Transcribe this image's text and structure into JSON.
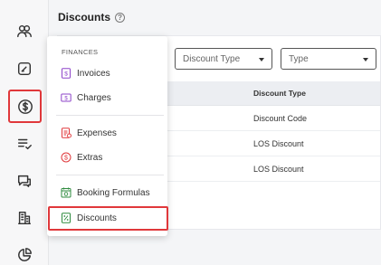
{
  "colors": {
    "accent_red": "#e0383b",
    "purple": "#8e44c9",
    "orange": "#e08a2c",
    "green": "#2e8b3e"
  },
  "header": {
    "title": "Discounts",
    "help_icon": "?"
  },
  "sidebar": {
    "icons": [
      "users-icon",
      "edit-icon",
      "dollar-icon",
      "checklist-icon",
      "chat-icon",
      "building-icon",
      "pie-chart-icon"
    ],
    "active": "dollar-icon"
  },
  "filters": {
    "discount_type": {
      "value": "Discount Type"
    },
    "type": {
      "value": "Type"
    }
  },
  "table": {
    "header": "Discount Type",
    "rows": [
      "Discount Code",
      "LOS Discount",
      "LOS Discount"
    ]
  },
  "menu": {
    "heading": "FINANCES",
    "items": [
      {
        "label": "Invoices",
        "icon": "invoice-icon"
      },
      {
        "label": "Charges",
        "icon": "charges-icon"
      },
      {
        "label": "Expenses",
        "icon": "expenses-icon"
      },
      {
        "label": "Extras",
        "icon": "extras-icon"
      },
      {
        "label": "Booking Formulas",
        "icon": "calculator-icon"
      },
      {
        "label": "Discounts",
        "icon": "discount-icon"
      }
    ],
    "selected": "Discounts"
  }
}
